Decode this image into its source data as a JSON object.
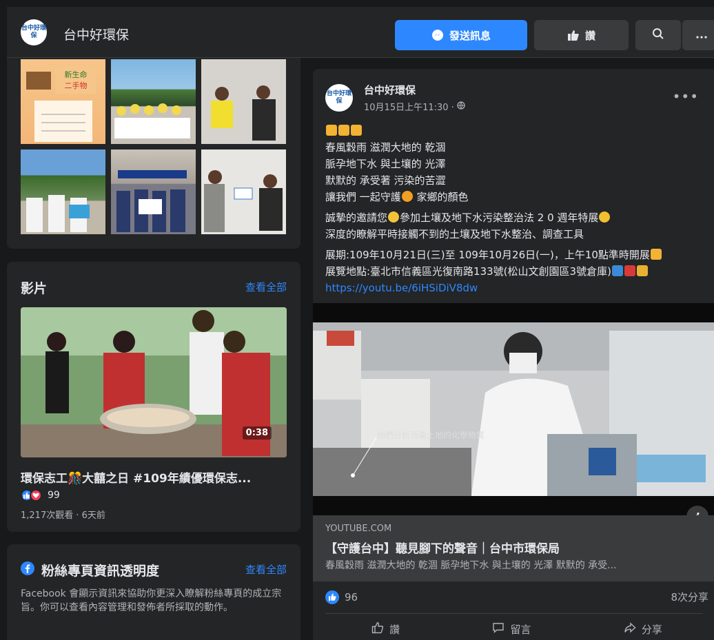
{
  "header": {
    "logo_text": "台中好環保",
    "page_name": "台中好環保",
    "message_button": "發送訊息",
    "like_button": "讚",
    "search_icon": "search-icon",
    "more_icon": "more-icon"
  },
  "videos_section": {
    "title": "影片",
    "see_all": "查看全部",
    "duration": "0:38",
    "video_title": "環保志工🎊大囍之日 #109年績優環保志...",
    "reaction_count": "99",
    "meta": "1,217次觀看 · 6天前"
  },
  "transparency_section": {
    "title": "粉絲專頁資訊透明度",
    "see_all": "查看全部",
    "description": "Facebook 會顯示資訊來協助你更深入瞭解粉絲專頁的成立宗旨。你可以查看內容管理和發佈者所採取的動作。"
  },
  "post": {
    "author": "台中好環保",
    "time": "10月15日上午11:30 ·",
    "line1": "春風穀雨 滋潤大地的 乾涸",
    "line2": "脈孕地下水 與土壤的 光澤",
    "line3": "默默的 承受著 污染的苦澀",
    "line4a": "讓我們 一起守護",
    "line4b": " 家鄉的顏色",
    "line5a": "誠摯的邀請您",
    "line5b": "參加土壤及地下水污染整治法 2 0 週年特展",
    "line6": "深度的瞭解平時接觸不到的土壤及地下水整治、調查工具",
    "line7": "展期:109年10月21日(三)至 109年10月26日(一)，上午10點準時開展",
    "line8": "展覽地點:臺北市信義區光復南路133號(松山文創園區3號倉庫)",
    "link": "https://youtu.be/6iHSiDiV8dw",
    "video_caption": "他們分析污染土地的化學物質",
    "link_domain": "YOUTUBE.COM",
    "link_title": "【守護台中】聽見腳下的聲音｜台中市環保局",
    "link_desc": "春風穀雨 滋潤大地的 乾涸 脈孕地下水 與土壤的 光澤 默默的 承受...",
    "like_count": "96",
    "shares": "8次分享",
    "action_like": "讚",
    "action_comment": "留言",
    "action_share": "分享"
  },
  "colors": {
    "background": "#18191a",
    "card": "#242526",
    "accent": "#2d88ff",
    "text": "#e4e6eb",
    "secondary_text": "#b0b3b8"
  }
}
